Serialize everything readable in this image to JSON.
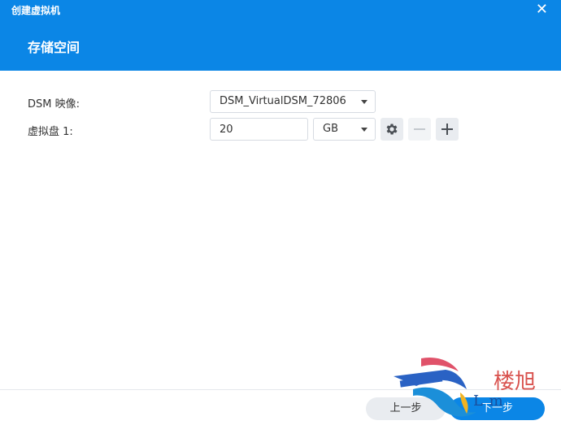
{
  "window": {
    "title": "创建虚拟机",
    "close_glyph": "✕"
  },
  "page": {
    "title": "存储空间"
  },
  "form": {
    "dsm_image": {
      "label": "DSM 映像:",
      "selected": "DSM_VirtualDSM_72806"
    },
    "virtual_disk": {
      "label": "虚拟盘 1:",
      "size_value": "20",
      "unit_selected": "GB"
    }
  },
  "icons": {
    "settings": "gear-icon",
    "remove": "minus-icon",
    "add": "plus-icon"
  },
  "footer": {
    "prev_label": "上一步",
    "next_label": "下一步"
  },
  "watermark": {
    "text": "楼旭",
    "sub": "L   m"
  },
  "colors": {
    "accent": "#0b86e6",
    "button_bg": "#e9ecf0"
  }
}
